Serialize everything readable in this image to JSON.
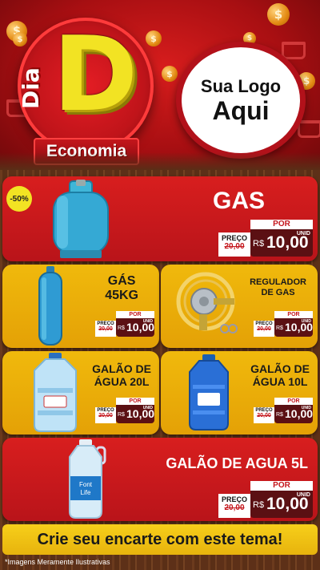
{
  "header": {
    "logo_word_top": "Dia",
    "logo_letter": "D",
    "logo_banner": "Economia",
    "placeholder_line1": "Sua Logo",
    "placeholder_line2": "Aqui",
    "decor_icons": [
      "dollar-coin-icon",
      "shopping-cart-icon"
    ]
  },
  "badge": {
    "text": "-50%"
  },
  "products": [
    {
      "title": "GAS",
      "preco_label": "PREÇO",
      "old_price": "20,00",
      "por_label": "POR",
      "currency": "R$",
      "price": "10,00",
      "unit": "UNID",
      "image": "gas-cylinder-icon"
    },
    {
      "title_line1": "GÁS",
      "title_line2": "45KG",
      "preco_label": "PREÇO",
      "old_price": "20,00",
      "por_label": "POR",
      "currency": "R$",
      "price": "10,00",
      "unit": "UNID",
      "image": "tall-gas-cylinder-icon"
    },
    {
      "title_line1": "REGULADOR",
      "title_line2": "DE GAS",
      "preco_label": "PREÇO",
      "old_price": "20,00",
      "por_label": "POR",
      "currency": "R$",
      "price": "10,00",
      "unit": "UNID",
      "image": "gas-regulator-icon"
    },
    {
      "title_line1": "GALÃO DE",
      "title_line2": "ÁGUA 20L",
      "preco_label": "PREÇO",
      "old_price": "20,00",
      "por_label": "POR",
      "currency": "R$",
      "price": "10,00",
      "unit": "UNID",
      "image": "water-jug-20l-icon"
    },
    {
      "title_line1": "GALÃO DE",
      "title_line2": "ÁGUA 10L",
      "preco_label": "PREÇO",
      "old_price": "20,00",
      "por_label": "POR",
      "currency": "R$",
      "price": "10,00",
      "unit": "UNID",
      "image": "water-jug-10l-icon"
    },
    {
      "title": "GALÃO DE AGUA 5L",
      "preco_label": "PREÇO",
      "old_price": "20,00",
      "por_label": "POR",
      "currency": "R$",
      "price": "10,00",
      "unit": "UNID",
      "image": "water-bottle-5l-icon",
      "bottle_label_line1": "Font",
      "bottle_label_line2": "Life"
    }
  ],
  "footer": {
    "cta": "Crie seu encarte com este tema!"
  },
  "disclaimer": "*Imagens Meramente Ilustrativas",
  "colors": {
    "red": "#c4161c",
    "yellow": "#f0b90c",
    "dark_red": "#5b1013",
    "wood": "#5a2e17"
  }
}
